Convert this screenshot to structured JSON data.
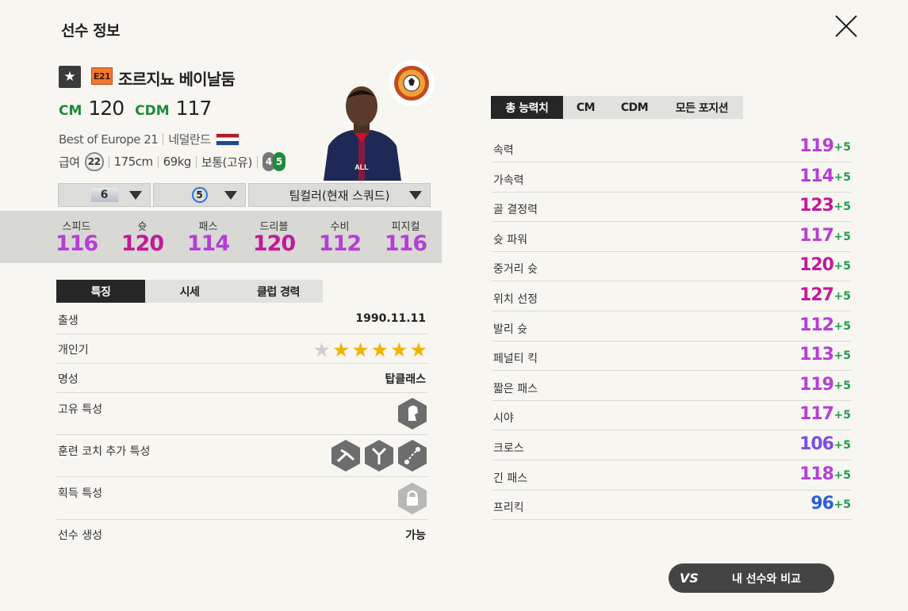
{
  "title": "선수 정보",
  "player": {
    "season_badge": "E21",
    "name": "조르지뇨 베이날둠",
    "positions": [
      {
        "code": "CM",
        "value": "120"
      },
      {
        "code": "CDM",
        "value": "117"
      }
    ],
    "season_name": "Best of Europe 21",
    "nation": "네덜란드",
    "pay_label": "급여",
    "pay": "22",
    "height": "175cm",
    "weight": "69kg",
    "body_type": "보통(고유)",
    "foot_left": "4",
    "foot_right": "5"
  },
  "selectors": {
    "enhance": "6",
    "level": "5",
    "team_color": "팀컬러(현재 스쿼드)"
  },
  "stats": [
    {
      "label": "스피드",
      "value": "116",
      "color": "#b63ed6"
    },
    {
      "label": "슛",
      "value": "120",
      "color": "#c2199a"
    },
    {
      "label": "패스",
      "value": "114",
      "color": "#b63ed6"
    },
    {
      "label": "드리블",
      "value": "120",
      "color": "#c2199a"
    },
    {
      "label": "수비",
      "value": "112",
      "color": "#b63ed6"
    },
    {
      "label": "피지컬",
      "value": "116",
      "color": "#b63ed6"
    }
  ],
  "left_tabs": [
    "특징",
    "시세",
    "클럽 경력"
  ],
  "traits": {
    "birth_label": "출생",
    "birth": "1990.11.11",
    "popularity_label": "개인기",
    "popularity_stars": 5,
    "reputation_label": "명성",
    "reputation": "탑클래스",
    "unique_label": "고유 특성",
    "coach_label": "훈련 코치 추가 특성",
    "acquired_label": "획득 특성",
    "create_label": "선수 생성",
    "create": "가능"
  },
  "right_tabs": [
    "총 능력치",
    "CM",
    "CDM",
    "모든 포지션"
  ],
  "abilities": [
    {
      "name": "속력",
      "value": "119",
      "bonus": "+5",
      "color": "#b63ed6"
    },
    {
      "name": "가속력",
      "value": "114",
      "bonus": "+5",
      "color": "#b63ed6"
    },
    {
      "name": "골 결정력",
      "value": "123",
      "bonus": "+5",
      "color": "#c2199a"
    },
    {
      "name": "슛 파워",
      "value": "117",
      "bonus": "+5",
      "color": "#b63ed6"
    },
    {
      "name": "중거리 슛",
      "value": "120",
      "bonus": "+5",
      "color": "#c2199a"
    },
    {
      "name": "위치 선정",
      "value": "127",
      "bonus": "+5",
      "color": "#c2199a"
    },
    {
      "name": "발리 슛",
      "value": "112",
      "bonus": "+5",
      "color": "#b63ed6"
    },
    {
      "name": "페널티 킥",
      "value": "113",
      "bonus": "+5",
      "color": "#b63ed6"
    },
    {
      "name": "짧은 패스",
      "value": "119",
      "bonus": "+5",
      "color": "#b63ed6"
    },
    {
      "name": "시야",
      "value": "117",
      "bonus": "+5",
      "color": "#b63ed6"
    },
    {
      "name": "크로스",
      "value": "106",
      "bonus": "+5",
      "color": "#7a4ee0"
    },
    {
      "name": "긴 패스",
      "value": "118",
      "bonus": "+5",
      "color": "#b63ed6"
    },
    {
      "name": "프리킥",
      "value": "96",
      "bonus": "+5",
      "color": "#2b5fd6"
    }
  ],
  "compare_button": "내 선수와 비교",
  "vs_icon_text": "VS"
}
